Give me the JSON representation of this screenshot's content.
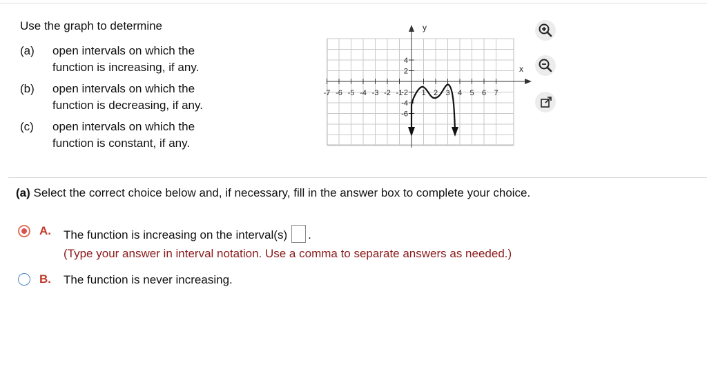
{
  "question": {
    "intro": "Use the graph to determine",
    "parts": [
      {
        "label": "(a)",
        "line1": "open intervals on which the",
        "line2": "function is increasing, if any."
      },
      {
        "label": "(b)",
        "line1": "open intervals on which the",
        "line2": "function is decreasing, if any."
      },
      {
        "label": "(c)",
        "line1": "open intervals on which the",
        "line2": "function is constant, if any."
      }
    ]
  },
  "graph": {
    "x_axis_label": "x",
    "y_axis_label": "y",
    "x_ticks": [
      "-7",
      "-6",
      "-5",
      "-4",
      "-3",
      "-2",
      "-1",
      "1",
      "2",
      "3",
      "4",
      "5",
      "6",
      "7"
    ],
    "y_ticks": [
      "4",
      "2",
      "-2",
      "-4",
      "-6"
    ]
  },
  "tools": {
    "zoom_in": "zoom-in-icon",
    "zoom_out": "zoom-out-icon",
    "popout": "popout-icon"
  },
  "instruction": {
    "label": "(a)",
    "text": "Select the correct choice below and, if necessary, fill in the answer box to complete your choice."
  },
  "choices": {
    "a": {
      "letter": "A.",
      "text": "The function is increasing on the interval(s)",
      "selected": true,
      "answer": "",
      "hint": "(Type your answer in interval notation. Use a comma to separate answers as needed.)"
    },
    "b": {
      "letter": "B.",
      "text": "The function is never increasing.",
      "selected": false
    }
  },
  "colors": {
    "letter": "#c0392b",
    "hint": "#8b1a1a",
    "radio_selected": "#d9534f",
    "radio_border": "#4a86c5"
  }
}
